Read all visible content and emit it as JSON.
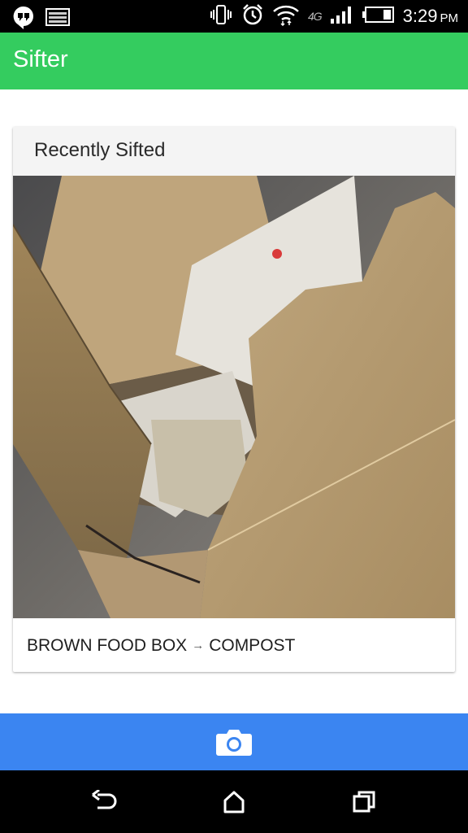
{
  "status_bar": {
    "time": "3:29",
    "ampm": "PM",
    "network": "4G",
    "icons": [
      "hangouts-icon",
      "notification-card-icon",
      "vibrate-icon",
      "alarm-icon",
      "wifi-icon",
      "signal-icon",
      "battery-icon"
    ]
  },
  "app_bar": {
    "title": "Sifter",
    "color": "#34cc5f"
  },
  "card": {
    "header": "Recently Sifted",
    "item": {
      "label": "BROWN FOOD BOX",
      "arrow": "→",
      "category": "COMPOST"
    }
  },
  "camera_bar": {
    "color": "#3b85f1",
    "icon": "camera-icon"
  },
  "nav_bar": {
    "buttons": [
      "back-icon",
      "home-icon",
      "recents-icon"
    ]
  }
}
